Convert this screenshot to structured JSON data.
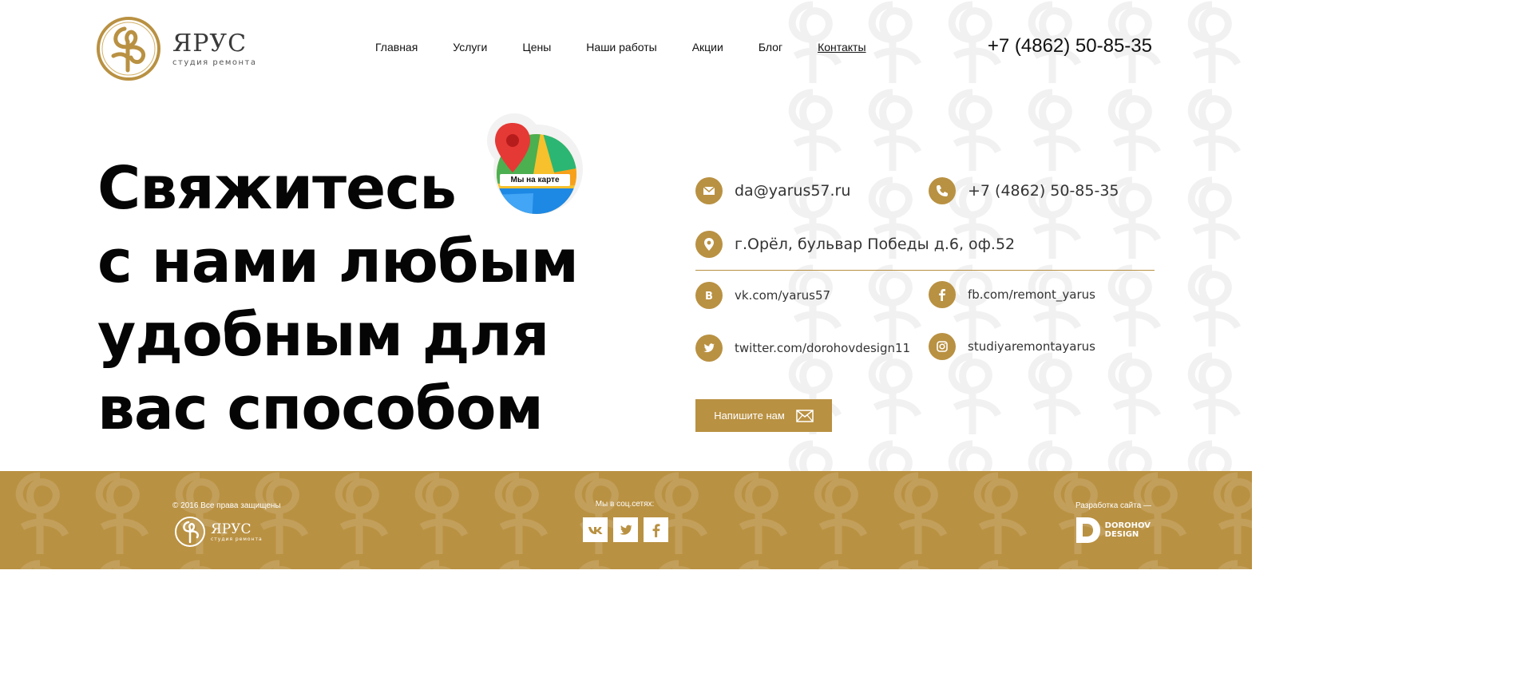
{
  "brand": {
    "name": "ЯРУС",
    "tagline": "студия ремонта",
    "accent_color": "#b99142"
  },
  "nav": {
    "items": [
      {
        "label": "Главная",
        "active": false
      },
      {
        "label": "Услуги",
        "active": false
      },
      {
        "label": "Цены",
        "active": false
      },
      {
        "label": "Наши работы",
        "active": false
      },
      {
        "label": "Акции",
        "active": false
      },
      {
        "label": "Блог",
        "active": false
      },
      {
        "label": "Контакты",
        "active": true
      }
    ]
  },
  "header": {
    "phone": "+7 (4862) 50-85-35"
  },
  "hero": {
    "lines": [
      "Свяжитесь",
      "с нами любым",
      "удобным для",
      "вас способом"
    ],
    "map_badge_label": "Мы на карте"
  },
  "contacts": {
    "email": "da@yarus57.ru",
    "phone": "+7 (4862) 50-85-35",
    "address": "г.Орёл, бульвар Победы д.6, оф.52",
    "vk": "vk.com/yarus57",
    "facebook": "fb.com/remont_yarus",
    "twitter": "twitter.com/dorohovdesign11",
    "instagram": "studiyaremontayarus"
  },
  "write_button": {
    "label": "Напишите нам",
    "icon": "envelope-icon"
  },
  "footer": {
    "copyright": "© 2016 Все права защищены",
    "social_title": "Мы в соц.сетях:",
    "social_icons": [
      "vk-icon",
      "twitter-icon",
      "facebook-icon"
    ],
    "developer_label": "Разработка сайта —",
    "developer_name_line1": "DOROHOV",
    "developer_name_line2": "DESIGN"
  }
}
